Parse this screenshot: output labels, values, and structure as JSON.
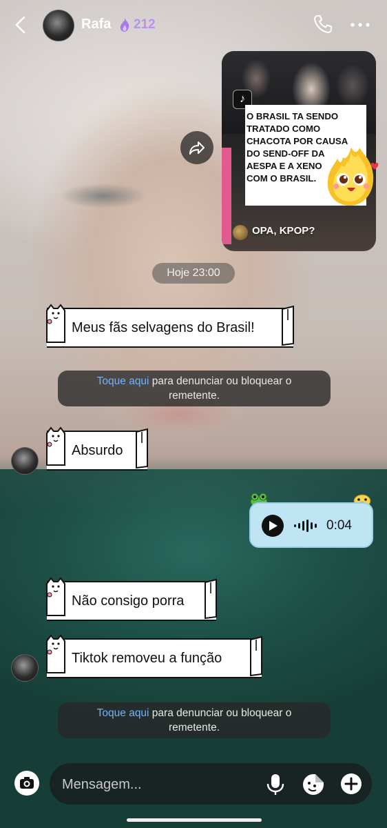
{
  "header": {
    "contact_name": "Rafa",
    "streak_count": "212",
    "icons": {
      "back": "chevron-left-icon",
      "call": "phone-icon",
      "more": "more-horizontal-icon",
      "streak": "flame-icon"
    }
  },
  "shared_video": {
    "caption_lines": [
      "O BRASIL TA SENDO",
      "TRATADO COMO",
      "CHACOTA POR CAUSA",
      "DO SEND-OFF DA",
      "AESPA E A XENO",
      "COM O BRASIL."
    ],
    "overlay_text": "OPA, KPOP?"
  },
  "timestamp": "Hoje 23:00",
  "messages": [
    {
      "text": "Meus fãs selvagens do Brasil!"
    },
    {
      "text": "Absurdo"
    },
    {
      "text": "Não consigo porra"
    },
    {
      "text": "Tiktok removeu a função"
    }
  ],
  "report_banner": {
    "link": "Toque aqui",
    "rest": " para denunciar ou bloquear o",
    "line2": "remetente."
  },
  "voice_message": {
    "duration": "0:04"
  },
  "composer": {
    "placeholder": "Mensagem..."
  },
  "colors": {
    "accent_link": "#6fb3ff",
    "streak": "#b792f0",
    "voice_bubble": "#bfe5f4"
  }
}
